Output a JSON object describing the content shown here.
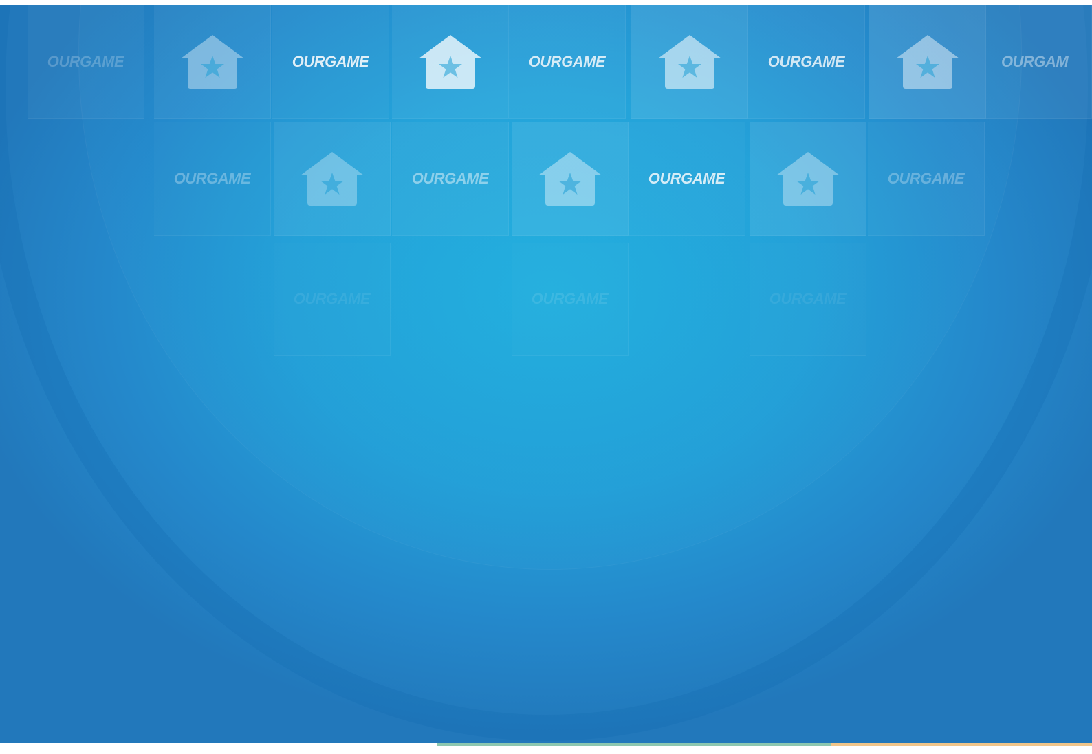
{
  "background": {
    "colors": {
      "center": "#22aedd",
      "edge": "#2278bb",
      "tile_tint": "#ffffff",
      "footer_accent_green": "#8cc7b0",
      "footer_accent_orange": "#f0c58a"
    }
  },
  "pattern": {
    "brand_text": "OURGAME",
    "cut_text": "OURGAM",
    "icon": "house-star-icon"
  }
}
